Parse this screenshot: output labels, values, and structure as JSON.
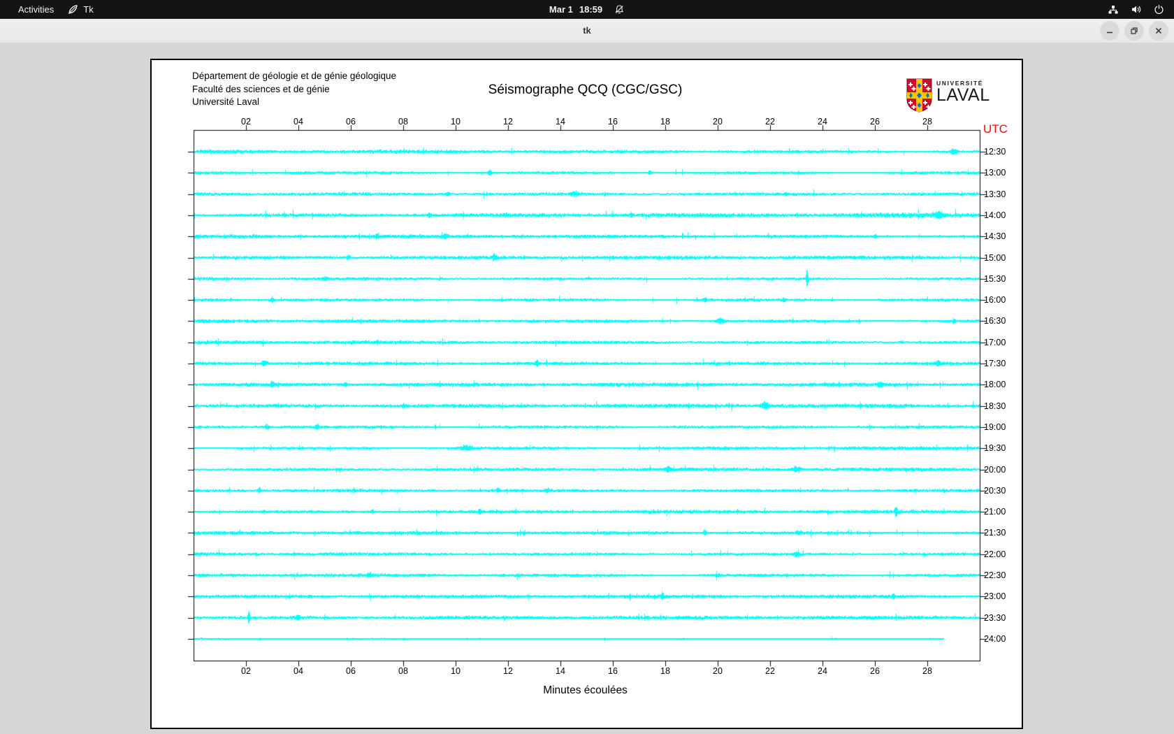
{
  "topbar": {
    "activities": "Activities",
    "app_name": "Tk",
    "date": "Mar 1",
    "time": "18:59"
  },
  "window": {
    "title": "tk"
  },
  "header": {
    "line1": "Département de géologie et de génie géologique",
    "line2": "Faculté des sciences et de génie",
    "line3": "Université Laval",
    "title": "Séismographe QCQ (CGC/GSC)"
  },
  "logo": {
    "line1": "UNIVERSITÉ",
    "line2": "LAVAL"
  },
  "chart_data": {
    "type": "seismogram-helicorder",
    "title": "Séismographe QCQ (CGC/GSC)",
    "xlabel": "Minutes écoulées",
    "utc_label": "UTC",
    "utc_color": "#ff0000",
    "trace_color": "#00ffff",
    "x_range_minutes": [
      0,
      30
    ],
    "x_ticks": [
      "02",
      "04",
      "06",
      "08",
      "10",
      "12",
      "14",
      "16",
      "18",
      "20",
      "22",
      "24",
      "26",
      "28"
    ],
    "rows": [
      {
        "label": "12:30",
        "gain": 1.0,
        "events": [
          [
            29,
            4,
            1.5
          ]
        ]
      },
      {
        "label": "13:00",
        "gain": 1.0,
        "events": [
          [
            11.3,
            4,
            0.8
          ],
          [
            17.4,
            3,
            0.8
          ]
        ]
      },
      {
        "label": "13:30",
        "gain": 1.05,
        "events": [
          [
            9.7,
            3,
            0.8
          ],
          [
            14.5,
            3,
            2
          ],
          [
            22.6,
            3,
            0.8
          ]
        ]
      },
      {
        "label": "14:00",
        "gain": 1.25,
        "events": [
          [
            9,
            4,
            0.8
          ],
          [
            11.9,
            3,
            0.8
          ],
          [
            16.7,
            3,
            0.8
          ],
          [
            28.4,
            5,
            2
          ]
        ]
      },
      {
        "label": "14:30",
        "gain": 1.0,
        "events": [
          [
            7,
            3,
            0.8
          ],
          [
            9.6,
            3,
            0.8
          ],
          [
            26,
            3,
            0.8
          ]
        ]
      },
      {
        "label": "15:00",
        "gain": 1.0,
        "events": [
          [
            5.9,
            4,
            0.8
          ],
          [
            11.5,
            3,
            0.8
          ]
        ]
      },
      {
        "label": "15:30",
        "gain": 0.95,
        "events": [
          [
            5,
            3,
            1.2
          ],
          [
            23.4,
            13,
            0.5
          ]
        ]
      },
      {
        "label": "16:00",
        "gain": 1.0,
        "events": [
          [
            3,
            4,
            0.8
          ],
          [
            19.5,
            3,
            0.8
          ],
          [
            22.5,
            3,
            0.8
          ]
        ]
      },
      {
        "label": "16:30",
        "gain": 1.0,
        "events": [
          [
            20.1,
            4,
            2
          ],
          [
            29,
            4,
            0.8
          ]
        ]
      },
      {
        "label": "17:00",
        "gain": 1.0,
        "events": [
          [
            27,
            3,
            0.8
          ]
        ]
      },
      {
        "label": "17:30",
        "gain": 1.2,
        "events": [
          [
            2.7,
            4,
            1.5
          ],
          [
            13.1,
            4,
            0.8
          ],
          [
            28.4,
            4,
            1.2
          ]
        ]
      },
      {
        "label": "18:00",
        "gain": 1.05,
        "events": [
          [
            3,
            4,
            0.8
          ],
          [
            5.8,
            3,
            0.8
          ],
          [
            26.2,
            4,
            0.8
          ]
        ]
      },
      {
        "label": "18:30",
        "gain": 1.05,
        "events": [
          [
            8,
            3,
            0.8
          ],
          [
            21.8,
            5,
            2.2
          ]
        ]
      },
      {
        "label": "19:00",
        "gain": 1.05,
        "events": [
          [
            2.8,
            3,
            1.2
          ],
          [
            4.7,
            4,
            0.8
          ]
        ]
      },
      {
        "label": "19:30",
        "gain": 1.0,
        "events": [
          [
            10.4,
            5,
            2.5
          ]
        ]
      },
      {
        "label": "20:00",
        "gain": 1.0,
        "events": [
          [
            18.1,
            3,
            1.2
          ],
          [
            23,
            4,
            2
          ]
        ]
      },
      {
        "label": "20:30",
        "gain": 1.1,
        "events": [
          [
            2.5,
            4,
            0.8
          ],
          [
            11.6,
            4,
            0.8
          ],
          [
            13.5,
            3,
            1.2
          ]
        ]
      },
      {
        "label": "21:00",
        "gain": 1.0,
        "events": [
          [
            6.8,
            3,
            0.8
          ],
          [
            10.9,
            3,
            0.8
          ],
          [
            26.8,
            7,
            0.6
          ]
        ]
      },
      {
        "label": "21:30",
        "gain": 1.0,
        "events": [
          [
            12.6,
            3,
            0.8
          ],
          [
            19.5,
            4,
            0.8
          ],
          [
            23.1,
            3,
            1.2
          ]
        ]
      },
      {
        "label": "22:00",
        "gain": 1.05,
        "events": [
          [
            23,
            3,
            1.2
          ]
        ]
      },
      {
        "label": "22:30",
        "gain": 1.1,
        "events": [
          [
            6.7,
            4,
            0.8
          ],
          [
            20,
            3,
            1.2
          ]
        ]
      },
      {
        "label": "23:00",
        "gain": 0.95,
        "events": [
          [
            17.9,
            3,
            0.8
          ],
          [
            26.7,
            3,
            0.8
          ]
        ]
      },
      {
        "label": "23:30",
        "gain": 1.0,
        "events": [
          [
            2.1,
            9,
            0.5
          ],
          [
            4,
            3,
            1.5
          ]
        ]
      },
      {
        "label": "24:00",
        "gain": 0.55,
        "end_minute": 28.6,
        "events": []
      }
    ]
  }
}
